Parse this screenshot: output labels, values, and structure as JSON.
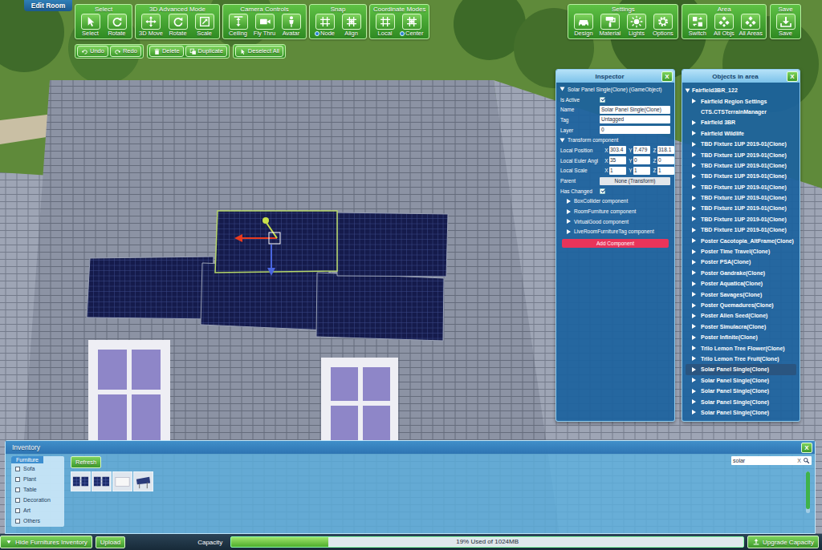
{
  "mode_tab": {
    "label": "Edit Room"
  },
  "toolbar": {
    "left_groups": [
      {
        "title": "Select",
        "buttons": [
          {
            "label": "Select",
            "kind": "plain"
          },
          {
            "label": "Rotate",
            "kind": "plain"
          }
        ]
      },
      {
        "title": "3D Advanced Mode",
        "buttons": [
          {
            "label": "3D Move",
            "kind": "plain"
          },
          {
            "label": "Rotate",
            "kind": "plain"
          },
          {
            "label": "Scale",
            "kind": "plain"
          }
        ]
      },
      {
        "title": "Camera Controls",
        "buttons": [
          {
            "label": "Ceiling",
            "kind": "plain"
          },
          {
            "label": "Fly Thru",
            "kind": "plain"
          },
          {
            "label": "Avatar",
            "kind": "plain"
          }
        ]
      },
      {
        "title": "Snap",
        "buttons": [
          {
            "label": "Node",
            "kind": "radio",
            "on": true
          },
          {
            "label": "Align",
            "kind": "plain"
          }
        ]
      },
      {
        "title": "Coordinate Modes",
        "buttons": [
          {
            "label": "Local",
            "kind": "plain"
          },
          {
            "label": "Center",
            "kind": "radio",
            "on": true
          }
        ]
      }
    ],
    "edit_groups": [
      [
        {
          "label": "Undo"
        },
        {
          "label": "Redo"
        }
      ],
      [
        {
          "label": "Delete"
        },
        {
          "label": "Duplicate"
        }
      ],
      [
        {
          "label": "Deselect All"
        }
      ]
    ],
    "right_groups": [
      {
        "title": "Settings",
        "buttons": [
          {
            "label": "Design",
            "kind": "plain"
          },
          {
            "label": "Material",
            "kind": "plain"
          },
          {
            "label": "Lights",
            "kind": "plain"
          },
          {
            "label": "Options",
            "kind": "plain"
          }
        ]
      },
      {
        "title": "Area",
        "buttons": [
          {
            "label": "Switch",
            "kind": "plain"
          },
          {
            "label": "All Objs",
            "kind": "plain"
          },
          {
            "label": "All Areas",
            "kind": "plain"
          }
        ]
      },
      {
        "title": "Save",
        "buttons": [
          {
            "label": "Save",
            "kind": "plain"
          }
        ]
      }
    ]
  },
  "inspector": {
    "title": "Inspector",
    "close": "X",
    "object": {
      "label": "Solar Panel Single(Clone) (GameObject)",
      "expanded": true
    },
    "is_active": {
      "label": "Is Active",
      "checked": true
    },
    "fields": [
      {
        "label": "Name",
        "value": "Solar Panel Single(Clone)"
      },
      {
        "label": "Tag",
        "value": "Untagged"
      },
      {
        "label": "Layer",
        "value": "0"
      }
    ],
    "transform": {
      "label": "Transform component",
      "expanded": true,
      "vectors": [
        {
          "label": "Local Position",
          "values": [
            {
              "axis": "X",
              "value": "303.4"
            },
            {
              "axis": "Y",
              "value": "7.479"
            },
            {
              "axis": "Z",
              "value": "318.1"
            }
          ]
        },
        {
          "label": "Local Euler Angl",
          "values": [
            {
              "axis": "X",
              "value": "35"
            },
            {
              "axis": "Y",
              "value": "0"
            },
            {
              "axis": "Z",
              "value": "0"
            }
          ]
        },
        {
          "label": "Local Scale",
          "values": [
            {
              "axis": "X",
              "value": "1"
            },
            {
              "axis": "Y",
              "value": "1"
            },
            {
              "axis": "Z",
              "value": "1"
            }
          ]
        }
      ],
      "parent": {
        "label": "Parent",
        "value": "None (Transform)"
      },
      "has_changed": {
        "label": "Has Changed",
        "checked": true
      }
    },
    "components": [
      {
        "label": "BoxCollider component",
        "expanded": false
      },
      {
        "label": "RoomFurniture component",
        "expanded": false
      },
      {
        "label": "VirtualGood component",
        "expanded": false
      },
      {
        "label": "LiveRoomFurnitureTag component",
        "expanded": false
      }
    ],
    "add_button": "Add Component"
  },
  "objects": {
    "title": "Objects in area",
    "close": "X",
    "root": {
      "label": "Fairfield3BR_122",
      "expanded": true
    },
    "items": [
      {
        "label": "Fairfield Region Settings",
        "has_children": true,
        "selected": false
      },
      {
        "label": "CTS.CTSTerrainManager",
        "has_children": false,
        "selected": false
      },
      {
        "label": "Fairfield 3BR",
        "has_children": true,
        "selected": false
      },
      {
        "label": "Fairfield Wildlife",
        "has_children": true,
        "selected": false
      },
      {
        "label": "TBD Fixture 1UP 2019-01(Clone)",
        "has_children": true,
        "selected": false
      },
      {
        "label": "TBD Fixture 1UP 2019-01(Clone)",
        "has_children": true,
        "selected": false
      },
      {
        "label": "TBD Fixture 1UP 2019-01(Clone)",
        "has_children": true,
        "selected": false
      },
      {
        "label": "TBD Fixture 1UP 2019-01(Clone)",
        "has_children": true,
        "selected": false
      },
      {
        "label": "TBD Fixture 1UP 2019-01(Clone)",
        "has_children": true,
        "selected": false
      },
      {
        "label": "TBD Fixture 1UP 2019-01(Clone)",
        "has_children": true,
        "selected": false
      },
      {
        "label": "TBD Fixture 1UP 2019-01(Clone)",
        "has_children": true,
        "selected": false
      },
      {
        "label": "TBD Fixture 1UP 2019-01(Clone)",
        "has_children": true,
        "selected": false
      },
      {
        "label": "TBD Fixture 1UP 2019-01(Clone)",
        "has_children": true,
        "selected": false
      },
      {
        "label": "Poster Cacotopia_AltFrame(Clone)",
        "has_children": true,
        "selected": false
      },
      {
        "label": "Poster Time Travel(Clone)",
        "has_children": true,
        "selected": false
      },
      {
        "label": "Poster PSA(Clone)",
        "has_children": true,
        "selected": false
      },
      {
        "label": "Poster Gandrake(Clone)",
        "has_children": true,
        "selected": false
      },
      {
        "label": "Poster Aquatica(Clone)",
        "has_children": true,
        "selected": false
      },
      {
        "label": "Poster Savages(Clone)",
        "has_children": true,
        "selected": false
      },
      {
        "label": "Poster Quemadures(Clone)",
        "has_children": true,
        "selected": false
      },
      {
        "label": "Poster Alien Seed(Clone)",
        "has_children": true,
        "selected": false
      },
      {
        "label": "Poster Simulacra(Clone)",
        "has_children": true,
        "selected": false
      },
      {
        "label": "Poster Infinite(Clone)",
        "has_children": true,
        "selected": false
      },
      {
        "label": "Trilo Lemon Tree Flower(Clone)",
        "has_children": true,
        "selected": false
      },
      {
        "label": "Trilo Lemon Tree Fruit(Clone)",
        "has_children": true,
        "selected": false
      },
      {
        "label": "Solar Panel Single(Clone)",
        "has_children": true,
        "selected": true
      },
      {
        "label": "Solar Panel Single(Clone)",
        "has_children": true,
        "selected": false
      },
      {
        "label": "Solar Panel Single(Clone)",
        "has_children": true,
        "selected": false
      },
      {
        "label": "Solar Panel Single(Clone)",
        "has_children": true,
        "selected": false
      },
      {
        "label": "Solar Panel Single(Clone)",
        "has_children": true,
        "selected": false
      }
    ]
  },
  "inventory": {
    "title": "Inventory",
    "close": "X",
    "tabs": [
      {
        "label": "Furniture",
        "selected": true
      }
    ],
    "categories": [
      {
        "label": "Sofa",
        "checked": false
      },
      {
        "label": "Plant",
        "checked": false
      },
      {
        "label": "Table",
        "checked": false
      },
      {
        "label": "Decoration",
        "checked": false
      },
      {
        "label": "Art",
        "checked": false
      },
      {
        "label": "Others",
        "checked": false
      }
    ],
    "refresh": "Refresh",
    "search": {
      "value": "solar",
      "clear": "X"
    },
    "thumbnails": [
      {
        "kind": "panel-flat"
      },
      {
        "kind": "panel-flat"
      },
      {
        "kind": "panel-white"
      },
      {
        "kind": "panel-stand"
      }
    ],
    "scroll": {
      "level": 0.9
    }
  },
  "status_bar": {
    "hide_inventory": "Hide Furnitures Inventory",
    "upload": "Upload",
    "capacity": {
      "label": "Capacity",
      "level": 0.19,
      "reading": "19% Used of 1024MB"
    },
    "upgrade": "Upgrade Capacity"
  }
}
